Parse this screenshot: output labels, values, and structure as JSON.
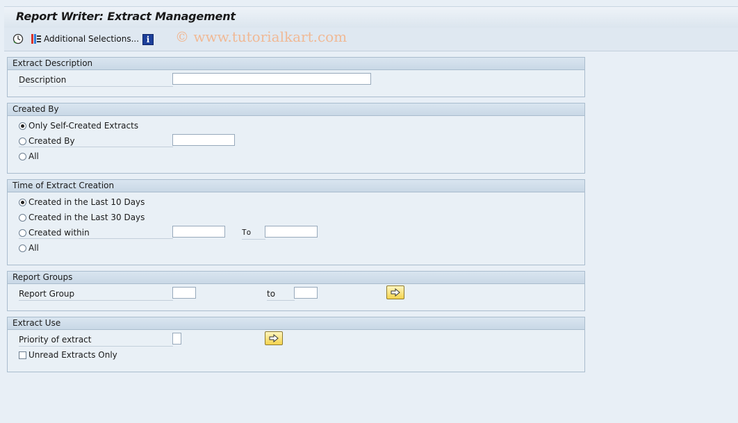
{
  "title": "Report Writer: Extract Management",
  "toolbar": {
    "additional_selections_label": "Additional Selections...",
    "watermark": "© www.tutorialkart.com"
  },
  "extract_description": {
    "header": "Extract Description",
    "description_label": "Description",
    "description_value": ""
  },
  "created_by": {
    "header": "Created By",
    "options": [
      "Only Self-Created Extracts",
      "Created By",
      "All"
    ],
    "selected": "Only Self-Created Extracts",
    "created_by_value": ""
  },
  "time_of_creation": {
    "header": "Time of Extract Creation",
    "options": [
      "Created in the Last 10 Days",
      "Created in the Last 30 Days",
      "Created within",
      "All"
    ],
    "selected": "Created in the Last 10 Days",
    "to_label": "To",
    "from_value": "",
    "to_value": ""
  },
  "report_groups": {
    "header": "Report Groups",
    "report_group_label": "Report Group",
    "to_label": "to",
    "from_value": "",
    "to_value": ""
  },
  "extract_use": {
    "header": "Extract Use",
    "priority_label": "Priority of extract",
    "priority_value": "",
    "unread_label": "Unread Extracts Only",
    "unread_checked": false
  },
  "colors": {
    "background": "#e8eff6",
    "group_header": "#c9d8e6",
    "arrow_button": "#f4d34e"
  }
}
